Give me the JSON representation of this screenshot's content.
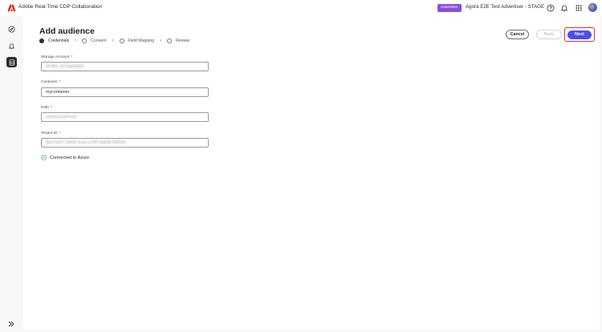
{
  "header": {
    "app_title": "Adobe Real-Time CDP Collaboration",
    "role_badge": "Advertiser",
    "org_name": "Agora E2E Test Advertiser - STAGE",
    "icons": [
      "help-icon",
      "notification-bell-icon",
      "app-switcher-icon",
      "user-avatar"
    ]
  },
  "sidebar": {
    "items": [
      {
        "icon": "compass-icon"
      },
      {
        "icon": "bell-alert-icon"
      },
      {
        "icon": "audience-data-icon",
        "active": true
      }
    ],
    "expand_icon": "chevron-double-right-icon"
  },
  "page": {
    "title": "Add audience"
  },
  "steps": [
    {
      "label": "Credentials",
      "current": true
    },
    {
      "label": "Consent",
      "current": false
    },
    {
      "label": "Field Mapping",
      "current": false
    },
    {
      "label": "Review",
      "current": false
    }
  ],
  "actions": {
    "cancel_label": "Cancel",
    "back_label": "Back",
    "next_label": "Next"
  },
  "form": {
    "storage_account": {
      "label": "Storage Account",
      "value": "testfoo.storageabba",
      "required": "*"
    },
    "container": {
      "label": "Container",
      "value": "mycontainer",
      "required": "*"
    },
    "path": {
      "label": "Path",
      "value": "source/path/test",
      "required": "*"
    },
    "tenant_id": {
      "label": "Tenant ID",
      "value": "0b47b2e7-94eb-4cea-a7d2-6eb9576602b",
      "required": "*"
    }
  },
  "status": {
    "text": "Connected to Azure",
    "color": "#2d9d78"
  },
  "colors": {
    "accent": "#4b4ff0",
    "badge": "#8a4fd8",
    "highlight_border": "#e0302a",
    "adobe_red": "#eb1000"
  }
}
